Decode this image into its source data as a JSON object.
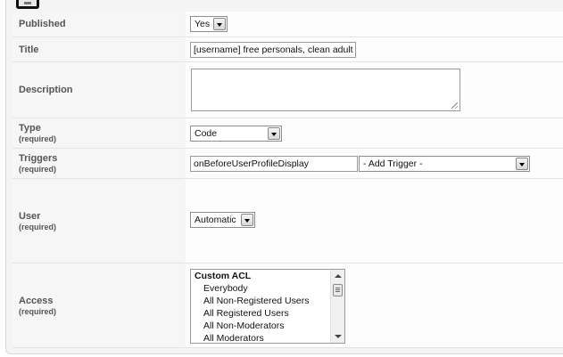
{
  "form": {
    "published": {
      "label": "Published",
      "value": "Yes"
    },
    "title": {
      "label": "Title",
      "value": "[username] free personals, clean adult s"
    },
    "description": {
      "label": "Description",
      "value": ""
    },
    "type": {
      "label": "Type",
      "required": "(required)",
      "value": "Code"
    },
    "triggers": {
      "label": "Triggers",
      "required": "(required)",
      "value": "onBeforeUserProfileDisplay",
      "add_trigger": "- Add Trigger -"
    },
    "user": {
      "label": "User",
      "required": "(required)",
      "value": "Automatic"
    },
    "access": {
      "label": "Access",
      "required": "(required)",
      "group_header": "Custom ACL",
      "options": [
        "Everybody",
        "All Non-Registered Users",
        "All Registered Users",
        "All Non-Moderators",
        "All Moderators"
      ]
    }
  },
  "icons": {
    "top": "edit-icon",
    "dropdown": "chevron-down-icon"
  }
}
